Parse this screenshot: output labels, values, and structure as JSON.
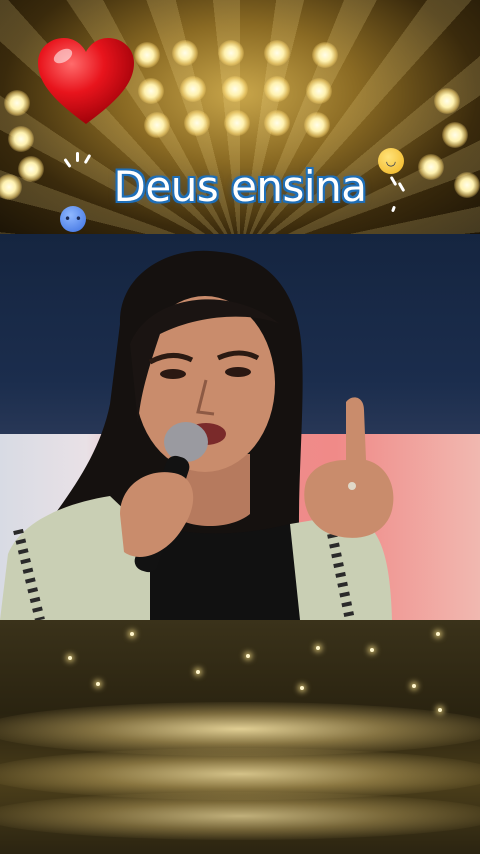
{
  "caption": {
    "title": "Deus ensina"
  },
  "colors": {
    "title_fill": "#ffffff",
    "title_outline": "#1f6fb8",
    "heart": "#e8141c",
    "stage_gold": "#c9a64a"
  },
  "icons": {
    "heart": "heart-emoji-icon",
    "sad_face": "sad-face-emoji-icon",
    "happy_face": "happy-face-emoji-icon"
  }
}
